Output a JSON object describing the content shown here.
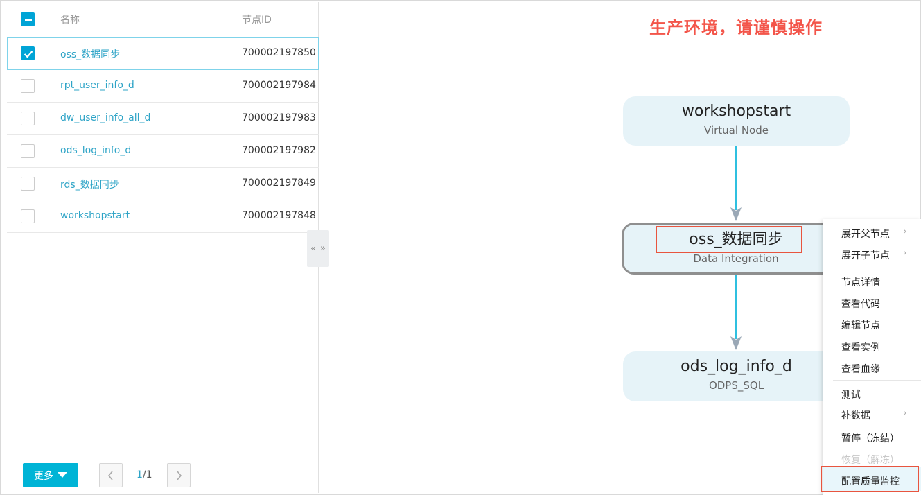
{
  "table": {
    "header_name": "名称",
    "header_id": "节点ID",
    "rows": [
      {
        "name": "oss_数据同步",
        "id": "700002197850",
        "checked": true
      },
      {
        "name": "rpt_user_info_d",
        "id": "700002197984",
        "checked": false
      },
      {
        "name": "dw_user_info_all_d",
        "id": "700002197983",
        "checked": false
      },
      {
        "name": "ods_log_info_d",
        "id": "700002197982",
        "checked": false
      },
      {
        "name": "rds_数据同步",
        "id": "700002197849",
        "checked": false
      },
      {
        "name": "workshopstart",
        "id": "700002197848",
        "checked": false
      }
    ]
  },
  "collapse_handle": {
    "left": "«",
    "right": "»"
  },
  "footer": {
    "more_label": "更多",
    "page_current": "1",
    "page_total": "/1"
  },
  "graph": {
    "warning": "生产环境，请谨慎操作",
    "nodes": [
      {
        "title": "workshopstart",
        "type": "Virtual Node"
      },
      {
        "title": "oss_数据同步",
        "type": "Data Integration"
      },
      {
        "title": "ods_log_info_d",
        "type": "ODPS_SQL"
      }
    ]
  },
  "context_menu": {
    "items": [
      {
        "label": "展开父节点",
        "submenu": true
      },
      {
        "label": "展开子节点",
        "submenu": true
      },
      {
        "label": "节点详情"
      },
      {
        "label": "查看代码"
      },
      {
        "label": "编辑节点"
      },
      {
        "label": "查看实例"
      },
      {
        "label": "查看血缘"
      },
      {
        "label": "测试"
      },
      {
        "label": "补数据",
        "submenu": true
      },
      {
        "label": "暂停（冻结）"
      },
      {
        "label": "恢复（解冻）",
        "disabled": true
      },
      {
        "label": "配置质量监控",
        "highlighted": true
      }
    ],
    "submenu_arrow": "›"
  },
  "colors": {
    "accent": "#00a4d6",
    "link": "#2ea4c7",
    "warning": "#f3554a",
    "highlight_box": "#e8553f",
    "edge": "#2fc0e0",
    "node_bg": "#e6f3f8"
  }
}
